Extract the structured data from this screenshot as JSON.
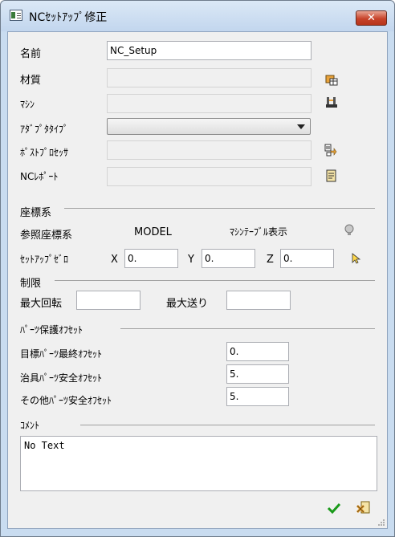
{
  "window": {
    "title": "NCｾｯﾄｱｯﾌﾟ修正",
    "close_label": "✕"
  },
  "name": {
    "label": "名前",
    "value": "NC_Setup"
  },
  "material": {
    "label": "材質",
    "value": ""
  },
  "machine": {
    "label": "ﾏｼﾝ",
    "value": ""
  },
  "adapter_type": {
    "label": "ｱﾀﾞﾌﾟﾀﾀｲﾌﾟ",
    "value": ""
  },
  "postprocessor": {
    "label": "ﾎﾟｽﾄﾌﾟﾛｾｯｻ",
    "value": ""
  },
  "nc_report": {
    "label": "NCﾚﾎﾟｰﾄ",
    "value": ""
  },
  "coordinate_system": {
    "section_label": "座標系",
    "reference_label": "参照座標系",
    "reference_value": "MODEL",
    "display_label": "ﾏｼﾝﾃｰﾌﾞﾙ表示",
    "setup_zero_label": "ｾｯﾄｱｯﾌﾟｾﾞﾛ",
    "x_label": "X",
    "x_value": "0.",
    "y_label": "Y",
    "y_value": "0.",
    "z_label": "Z",
    "z_value": "0."
  },
  "limits": {
    "section_label": "制限",
    "max_rotation_label": "最大回転",
    "max_rotation_value": "",
    "max_feed_label": "最大送り",
    "max_feed_value": ""
  },
  "part_offset": {
    "section_label": "ﾊﾟｰﾂ保護ｵﾌｾｯﾄ",
    "target_label": "目標ﾊﾟｰﾂ最終ｵﾌｾｯﾄ",
    "target_value": "0.",
    "fixture_label": "治具ﾊﾟｰﾂ安全ｵﾌｾｯﾄ",
    "fixture_value": "5.",
    "other_label": "その他ﾊﾟｰﾂ安全ｵﾌｾｯﾄ",
    "other_value": "5."
  },
  "comment": {
    "section_label": "ｺﾒﾝﾄ",
    "value": "No Text"
  },
  "colors": {
    "ok": "#1a9a1a",
    "accent": "#c7432a"
  }
}
